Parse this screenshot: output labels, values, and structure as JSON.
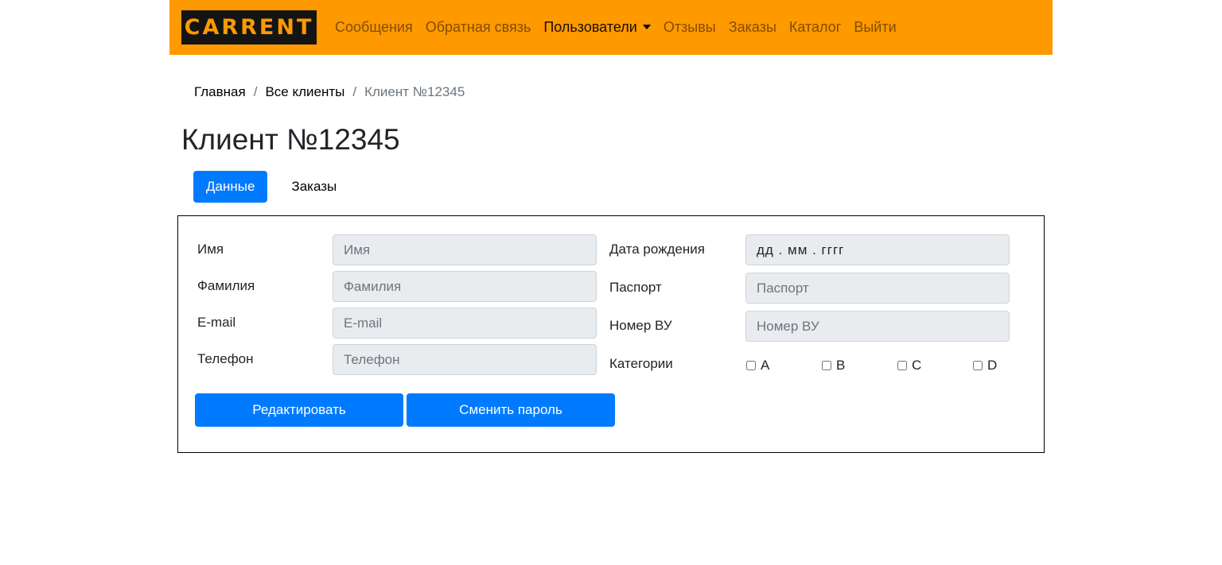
{
  "brand": {
    "logo_text": "CARRENT",
    "accent_color": "#ff9900",
    "primary_color": "#007bff"
  },
  "nav": {
    "items": [
      {
        "label": "Сообщения"
      },
      {
        "label": "Обратная связь"
      },
      {
        "label": "Пользователи",
        "active": true,
        "dropdown": true
      },
      {
        "label": "Отзывы"
      },
      {
        "label": "Заказы"
      },
      {
        "label": "Каталог"
      },
      {
        "label": "Выйти"
      }
    ]
  },
  "breadcrumb": {
    "home": "Главная",
    "clients": "Все клиенты",
    "current": "Клиент №12345",
    "separator": "/"
  },
  "page": {
    "title": "Клиент №12345"
  },
  "tabs": [
    {
      "label": "Данные",
      "active": true
    },
    {
      "label": "Заказы",
      "active": false
    }
  ],
  "form": {
    "first_name": {
      "label": "Имя",
      "placeholder": "Имя",
      "value": ""
    },
    "last_name": {
      "label": "Фамилия",
      "placeholder": "Фамилия",
      "value": ""
    },
    "email": {
      "label": "E-mail",
      "placeholder": "E-mail",
      "value": ""
    },
    "phone": {
      "label": "Телефон",
      "placeholder": "Телефон",
      "value": ""
    },
    "birth_date": {
      "label": "Дата рождения",
      "placeholder": "дд . мм . гггг"
    },
    "passport": {
      "label": "Паспорт",
      "placeholder": "Паспорт",
      "value": ""
    },
    "license": {
      "label": "Номер ВУ",
      "placeholder": "Номер ВУ",
      "value": ""
    },
    "categories": {
      "label": "Категории",
      "items": [
        {
          "label": "A",
          "checked": false
        },
        {
          "label": "B",
          "checked": false
        },
        {
          "label": "C",
          "checked": false
        },
        {
          "label": "D",
          "checked": false
        }
      ]
    }
  },
  "actions": {
    "edit_label": "Редактировать",
    "change_password_label": "Сменить пароль"
  }
}
